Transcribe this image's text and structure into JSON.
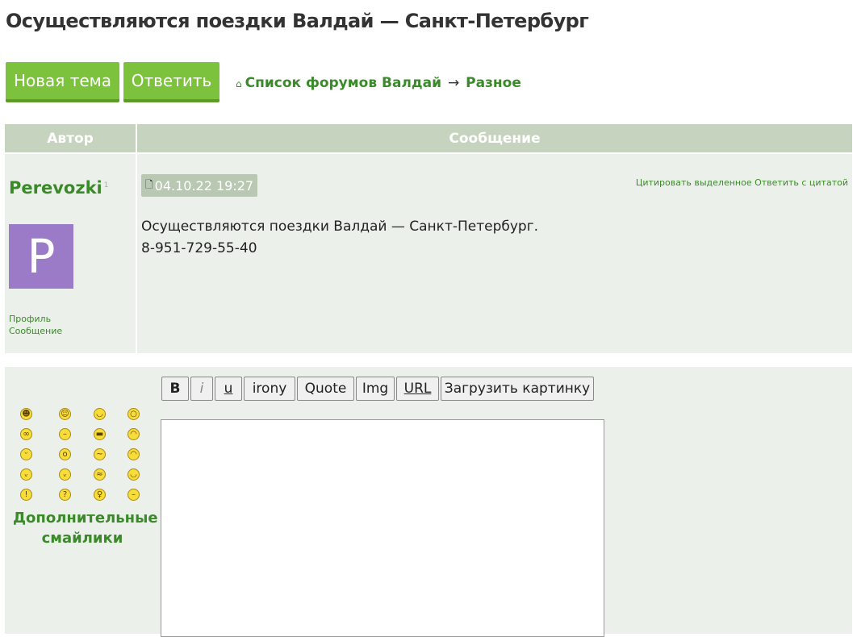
{
  "topic": {
    "title": "Осуществляются поездки Валдай — Санкт-Петербург"
  },
  "actions": {
    "new_topic": "Новая тема",
    "reply": "Ответить"
  },
  "breadcrumb": {
    "home_icon": "⌂",
    "forum_list": "Список форумов Валдай",
    "separator": "→",
    "section": "Разное"
  },
  "table": {
    "author_header": "Автор",
    "message_header": "Сообщение"
  },
  "post": {
    "username": "Perevozki",
    "user_marker": "1",
    "avatar_letter": "P",
    "avatar_color": "#9b7ac7",
    "profile_link": "Профиль",
    "message_link": "Сообщение",
    "doc_icon": "🗋",
    "date": "04.10.22 19:27",
    "quote_selected": "Цитировать выделенное",
    "reply_with_quote": "Ответить с цитатой",
    "text_line1": "Осуществляются поездки Валдай — Санкт-Петербург.",
    "text_line2": "8-951-729-55-40"
  },
  "editor": {
    "toolbar": {
      "bold": "B",
      "italic": "i",
      "underline": "u",
      "irony": "irony",
      "quote": "Quote",
      "img": "Img",
      "url": "URL",
      "upload": "Загрузить картинку"
    },
    "more_smileys_line1": "Дополнительные",
    "more_smileys_line2": "смайлики",
    "smileys": [
      "grin",
      "smile",
      "wink",
      "surprised",
      "nerd",
      "neutral",
      "cool",
      "laugh",
      "tongue",
      "shock",
      "sleepy",
      "sad",
      "devil",
      "evil-grin",
      "confused",
      "happy",
      "exclaim",
      "question",
      "idea",
      "meh"
    ]
  },
  "colors": {
    "accent": "#7cc23c",
    "link": "#3b8a2a",
    "header_bg": "#c6d4bf",
    "panel_bg": "#ecf0ea"
  }
}
